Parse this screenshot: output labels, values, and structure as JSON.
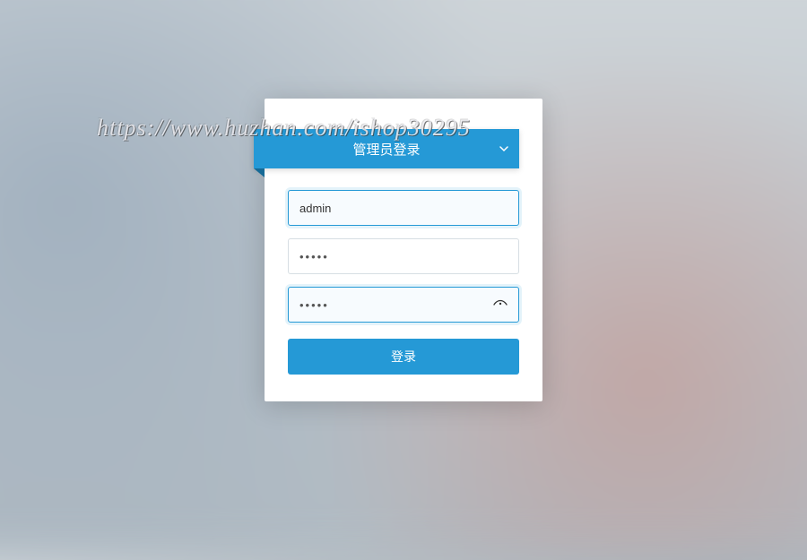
{
  "watermark": "https://www.huzhan.com/ishop30295",
  "header": {
    "title": "管理员登录"
  },
  "form": {
    "username": {
      "value": "admin",
      "placeholder": ""
    },
    "password": {
      "value": "•••••",
      "placeholder": ""
    },
    "captcha": {
      "value": "•••••",
      "placeholder": ""
    },
    "submit_label": "登录"
  }
}
